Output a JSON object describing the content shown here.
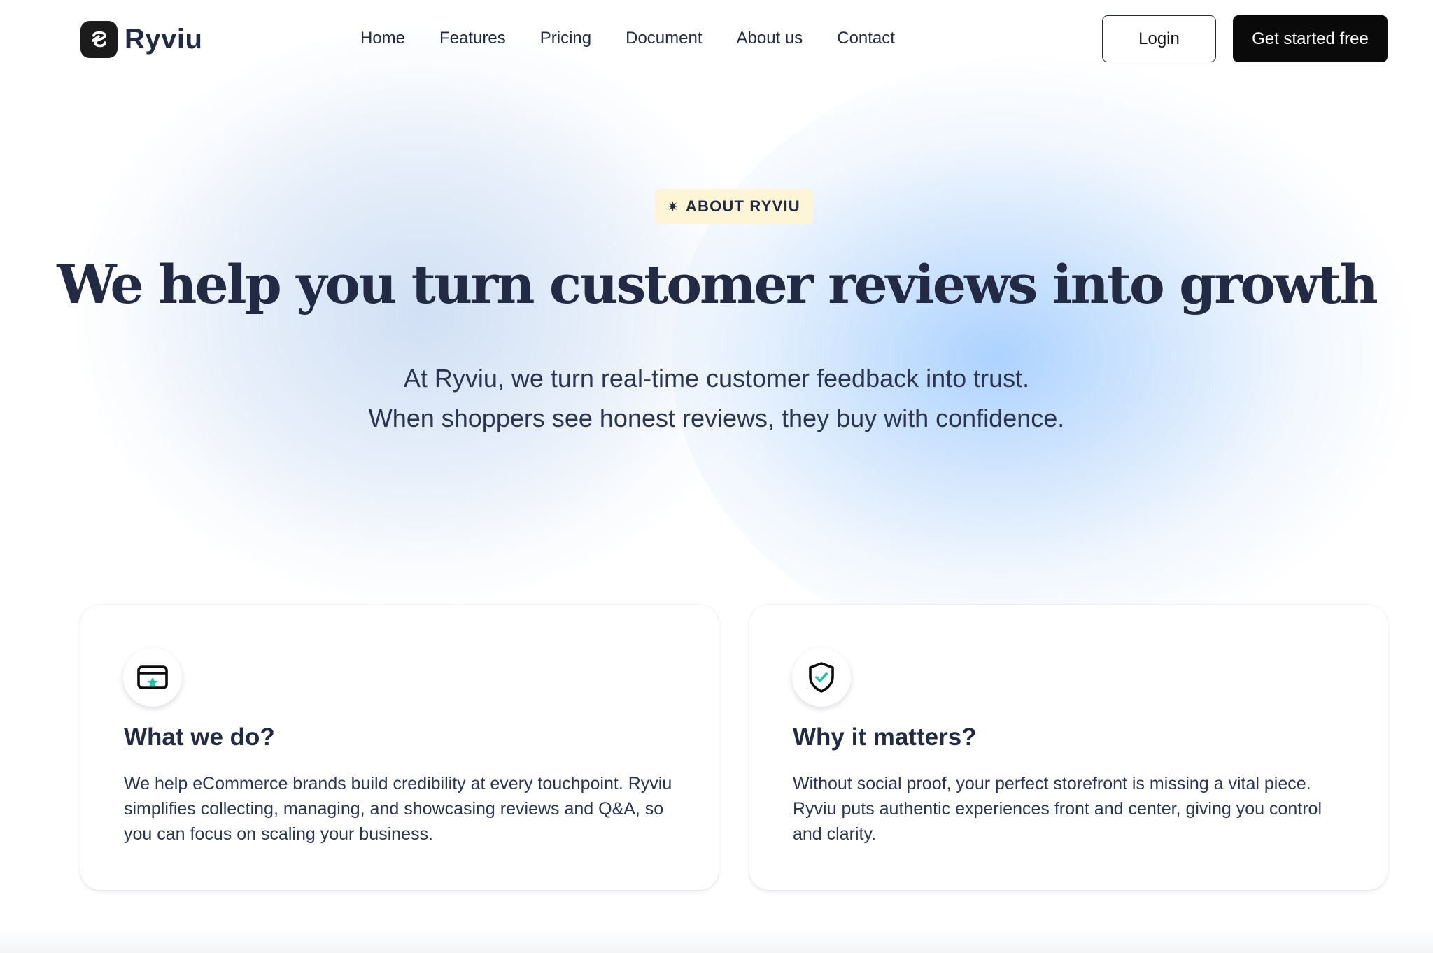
{
  "brand": {
    "name": "Ryviu",
    "logo_icon": "ryviu-logo-icon"
  },
  "nav": {
    "links": [
      "Home",
      "Features",
      "Pricing",
      "Document",
      "About us",
      "Contact"
    ],
    "login_label": "Login",
    "cta_label": "Get started free"
  },
  "hero": {
    "badge_icon": "sparkle-icon",
    "badge_label": "ABOUT RYVIU",
    "title": "We help you turn customer reviews into growth",
    "subtitle_line1": "At Ryviu, we turn real-time customer feedback into trust.",
    "subtitle_line2": "When shoppers see honest reviews, they buy with confidence."
  },
  "cards": [
    {
      "icon": "storefront-card-icon",
      "title": "What we do?",
      "text": "We help eCommerce brands build credibility at every touchpoint. Ryviu simplifies collecting, managing, and showcasing reviews and Q&A, so you can focus on scaling your business."
    },
    {
      "icon": "shield-check-icon",
      "title": "Why it matters?",
      "text": "Without social proof, your perfect storefront is missing a vital piece. Ryviu puts authentic experiences front and center, giving you control and clarity."
    }
  ],
  "colors": {
    "text_primary": "#222a44",
    "accent_teal": "#1fc2a5",
    "badge_bg": "#fdf5d6",
    "cta_bg": "#0a0a0a"
  }
}
